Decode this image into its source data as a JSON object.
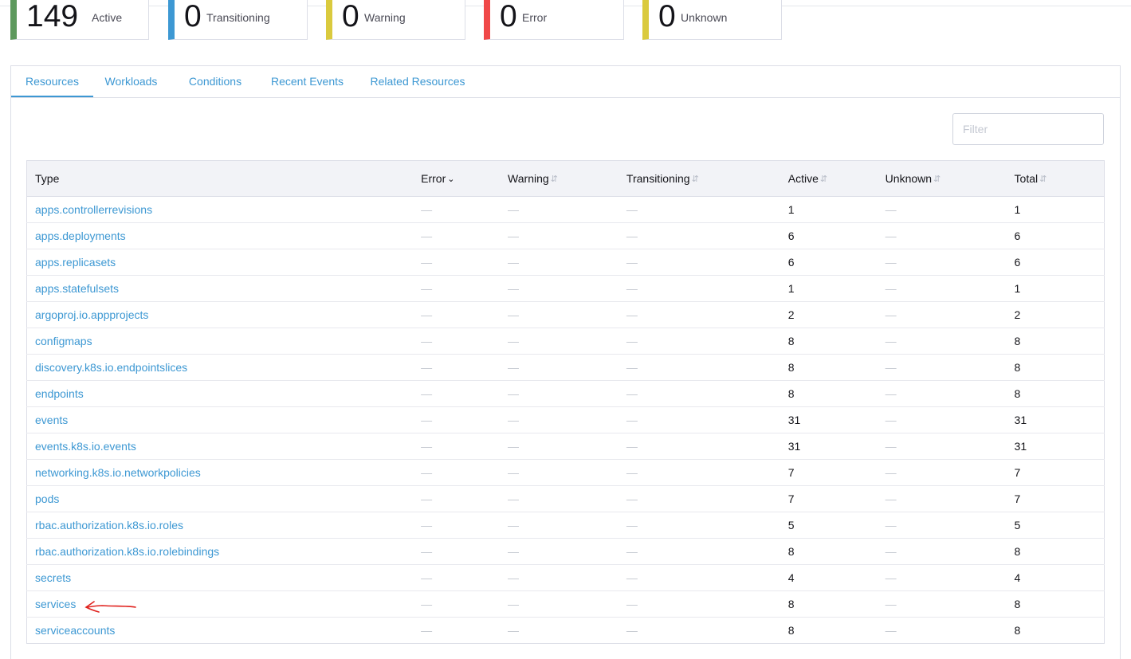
{
  "summary": [
    {
      "count": "149",
      "label": "Active",
      "color": "#5d995d"
    },
    {
      "count": "0",
      "label": "Transitioning",
      "color": "#3d98d3"
    },
    {
      "count": "0",
      "label": "Warning",
      "color": "#daca3e"
    },
    {
      "count": "0",
      "label": "Error",
      "color": "#f04848"
    },
    {
      "count": "0",
      "label": "Unknown",
      "color": "#daca3e"
    }
  ],
  "tabs": [
    {
      "label": "Resources",
      "active": true
    },
    {
      "label": "Workloads",
      "active": false
    },
    {
      "label": "Conditions",
      "active": false
    },
    {
      "label": "Recent Events",
      "active": false
    },
    {
      "label": "Related Resources",
      "active": false
    }
  ],
  "filter": {
    "placeholder": "Filter",
    "value": ""
  },
  "table": {
    "headers": [
      "Type",
      "Error",
      "Warning",
      "Transitioning",
      "Active",
      "Unknown",
      "Total"
    ],
    "sorted_column": "Error",
    "empty_symbol": "—",
    "rows": [
      {
        "type": "apps.controllerrevisions",
        "error": "—",
        "warning": "—",
        "transitioning": "—",
        "active": "1",
        "unknown": "—",
        "total": "1"
      },
      {
        "type": "apps.deployments",
        "error": "—",
        "warning": "—",
        "transitioning": "—",
        "active": "6",
        "unknown": "—",
        "total": "6"
      },
      {
        "type": "apps.replicasets",
        "error": "—",
        "warning": "—",
        "transitioning": "—",
        "active": "6",
        "unknown": "—",
        "total": "6"
      },
      {
        "type": "apps.statefulsets",
        "error": "—",
        "warning": "—",
        "transitioning": "—",
        "active": "1",
        "unknown": "—",
        "total": "1"
      },
      {
        "type": "argoproj.io.appprojects",
        "error": "—",
        "warning": "—",
        "transitioning": "—",
        "active": "2",
        "unknown": "—",
        "total": "2"
      },
      {
        "type": "configmaps",
        "error": "—",
        "warning": "—",
        "transitioning": "—",
        "active": "8",
        "unknown": "—",
        "total": "8"
      },
      {
        "type": "discovery.k8s.io.endpointslices",
        "error": "—",
        "warning": "—",
        "transitioning": "—",
        "active": "8",
        "unknown": "—",
        "total": "8"
      },
      {
        "type": "endpoints",
        "error": "—",
        "warning": "—",
        "transitioning": "—",
        "active": "8",
        "unknown": "—",
        "total": "8"
      },
      {
        "type": "events",
        "error": "—",
        "warning": "—",
        "transitioning": "—",
        "active": "31",
        "unknown": "—",
        "total": "31"
      },
      {
        "type": "events.k8s.io.events",
        "error": "—",
        "warning": "—",
        "transitioning": "—",
        "active": "31",
        "unknown": "—",
        "total": "31"
      },
      {
        "type": "networking.k8s.io.networkpolicies",
        "error": "—",
        "warning": "—",
        "transitioning": "—",
        "active": "7",
        "unknown": "—",
        "total": "7"
      },
      {
        "type": "pods",
        "error": "—",
        "warning": "—",
        "transitioning": "—",
        "active": "7",
        "unknown": "—",
        "total": "7"
      },
      {
        "type": "rbac.authorization.k8s.io.roles",
        "error": "—",
        "warning": "—",
        "transitioning": "—",
        "active": "5",
        "unknown": "—",
        "total": "5"
      },
      {
        "type": "rbac.authorization.k8s.io.rolebindings",
        "error": "—",
        "warning": "—",
        "transitioning": "—",
        "active": "8",
        "unknown": "—",
        "total": "8"
      },
      {
        "type": "secrets",
        "error": "—",
        "warning": "—",
        "transitioning": "—",
        "active": "4",
        "unknown": "—",
        "total": "4"
      },
      {
        "type": "services",
        "error": "—",
        "warning": "—",
        "transitioning": "—",
        "active": "8",
        "unknown": "—",
        "total": "8"
      },
      {
        "type": "serviceaccounts",
        "error": "—",
        "warning": "—",
        "transitioning": "—",
        "active": "8",
        "unknown": "—",
        "total": "8"
      }
    ]
  },
  "annotation": {
    "icon": "hand-drawn-arrow-icon",
    "color": "#e0211d"
  }
}
